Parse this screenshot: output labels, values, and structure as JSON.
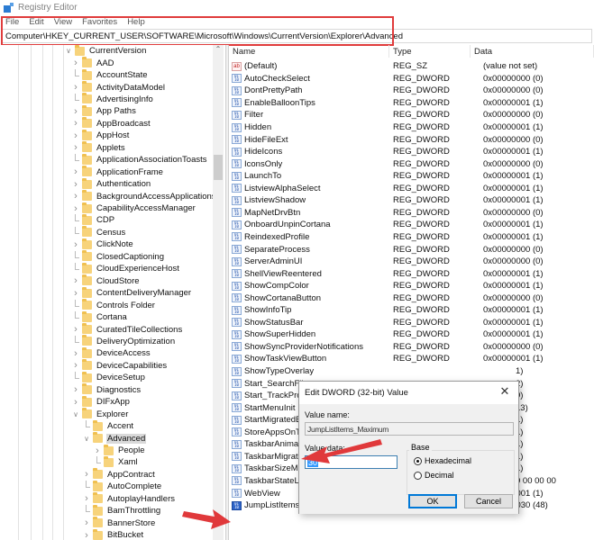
{
  "window": {
    "title": "Registry Editor",
    "app_icon": "registry-editor-icon"
  },
  "menu": [
    "File",
    "Edit",
    "View",
    "Favorites",
    "Help"
  ],
  "address": "Computer\\HKEY_CURRENT_USER\\SOFTWARE\\Microsoft\\Windows\\CurrentVersion\\Explorer\\Advanced",
  "accent": {
    "highlight_box": "#e03c3c",
    "annotation_arrow": "#e0393b",
    "selection": "#d9d9d9"
  },
  "tree": {
    "items": [
      {
        "label": "CurrentVersion",
        "level": 0,
        "expander": "expanded"
      },
      {
        "label": "AAD",
        "level": 1,
        "expander": "collapsed"
      },
      {
        "label": "AccountState",
        "level": 1,
        "expander": "none"
      },
      {
        "label": "ActivityDataModel",
        "level": 1,
        "expander": "collapsed"
      },
      {
        "label": "AdvertisingInfo",
        "level": 1,
        "expander": "none"
      },
      {
        "label": "App Paths",
        "level": 1,
        "expander": "collapsed"
      },
      {
        "label": "AppBroadcast",
        "level": 1,
        "expander": "collapsed"
      },
      {
        "label": "AppHost",
        "level": 1,
        "expander": "collapsed"
      },
      {
        "label": "Applets",
        "level": 1,
        "expander": "collapsed"
      },
      {
        "label": "ApplicationAssociationToasts",
        "level": 1,
        "expander": "none"
      },
      {
        "label": "ApplicationFrame",
        "level": 1,
        "expander": "collapsed"
      },
      {
        "label": "Authentication",
        "level": 1,
        "expander": "collapsed"
      },
      {
        "label": "BackgroundAccessApplications",
        "level": 1,
        "expander": "collapsed"
      },
      {
        "label": "CapabilityAccessManager",
        "level": 1,
        "expander": "collapsed"
      },
      {
        "label": "CDP",
        "level": 1,
        "expander": "none"
      },
      {
        "label": "Census",
        "level": 1,
        "expander": "none"
      },
      {
        "label": "ClickNote",
        "level": 1,
        "expander": "collapsed"
      },
      {
        "label": "ClosedCaptioning",
        "level": 1,
        "expander": "none"
      },
      {
        "label": "CloudExperienceHost",
        "level": 1,
        "expander": "none"
      },
      {
        "label": "CloudStore",
        "level": 1,
        "expander": "collapsed"
      },
      {
        "label": "ContentDeliveryManager",
        "level": 1,
        "expander": "collapsed"
      },
      {
        "label": "Controls Folder",
        "level": 1,
        "expander": "none"
      },
      {
        "label": "Cortana",
        "level": 1,
        "expander": "none"
      },
      {
        "label": "CuratedTileCollections",
        "level": 1,
        "expander": "collapsed"
      },
      {
        "label": "DeliveryOptimization",
        "level": 1,
        "expander": "none"
      },
      {
        "label": "DeviceAccess",
        "level": 1,
        "expander": "collapsed"
      },
      {
        "label": "DeviceCapabilities",
        "level": 1,
        "expander": "collapsed"
      },
      {
        "label": "DeviceSetup",
        "level": 1,
        "expander": "none"
      },
      {
        "label": "Diagnostics",
        "level": 1,
        "expander": "collapsed"
      },
      {
        "label": "DIFxApp",
        "level": 1,
        "expander": "collapsed"
      },
      {
        "label": "Explorer",
        "level": 1,
        "expander": "expanded"
      },
      {
        "label": "Accent",
        "level": 2,
        "expander": "none"
      },
      {
        "label": "Advanced",
        "level": 2,
        "expander": "expanded",
        "selected": true
      },
      {
        "label": "People",
        "level": 3,
        "expander": "collapsed"
      },
      {
        "label": "Xaml",
        "level": 3,
        "expander": "none"
      },
      {
        "label": "AppContract",
        "level": 2,
        "expander": "collapsed"
      },
      {
        "label": "AutoComplete",
        "level": 2,
        "expander": "none"
      },
      {
        "label": "AutoplayHandlers",
        "level": 2,
        "expander": "collapsed"
      },
      {
        "label": "BamThrottling",
        "level": 2,
        "expander": "none"
      },
      {
        "label": "BannerStore",
        "level": 2,
        "expander": "collapsed"
      },
      {
        "label": "BitBucket",
        "level": 2,
        "expander": "collapsed"
      }
    ]
  },
  "list": {
    "columns": {
      "name": "Name",
      "type": "Type",
      "data": "Data"
    },
    "rows": [
      {
        "name": "(Default)",
        "type": "REG_SZ",
        "data": "(value not set)",
        "icon": "string-value-icon"
      },
      {
        "name": "AutoCheckSelect",
        "type": "REG_DWORD",
        "data": "0x00000000 (0)",
        "icon": "dword-value-icon"
      },
      {
        "name": "DontPrettyPath",
        "type": "REG_DWORD",
        "data": "0x00000000 (0)",
        "icon": "dword-value-icon"
      },
      {
        "name": "EnableBalloonTips",
        "type": "REG_DWORD",
        "data": "0x00000001 (1)",
        "icon": "dword-value-icon"
      },
      {
        "name": "Filter",
        "type": "REG_DWORD",
        "data": "0x00000000 (0)",
        "icon": "dword-value-icon"
      },
      {
        "name": "Hidden",
        "type": "REG_DWORD",
        "data": "0x00000001 (1)",
        "icon": "dword-value-icon"
      },
      {
        "name": "HideFileExt",
        "type": "REG_DWORD",
        "data": "0x00000000 (0)",
        "icon": "dword-value-icon"
      },
      {
        "name": "HideIcons",
        "type": "REG_DWORD",
        "data": "0x00000001 (1)",
        "icon": "dword-value-icon"
      },
      {
        "name": "IconsOnly",
        "type": "REG_DWORD",
        "data": "0x00000000 (0)",
        "icon": "dword-value-icon"
      },
      {
        "name": "LaunchTo",
        "type": "REG_DWORD",
        "data": "0x00000001 (1)",
        "icon": "dword-value-icon"
      },
      {
        "name": "ListviewAlphaSelect",
        "type": "REG_DWORD",
        "data": "0x00000001 (1)",
        "icon": "dword-value-icon"
      },
      {
        "name": "ListviewShadow",
        "type": "REG_DWORD",
        "data": "0x00000001 (1)",
        "icon": "dword-value-icon"
      },
      {
        "name": "MapNetDrvBtn",
        "type": "REG_DWORD",
        "data": "0x00000000 (0)",
        "icon": "dword-value-icon"
      },
      {
        "name": "OnboardUnpinCortana",
        "type": "REG_DWORD",
        "data": "0x00000001 (1)",
        "icon": "dword-value-icon"
      },
      {
        "name": "ReindexedProfile",
        "type": "REG_DWORD",
        "data": "0x00000001 (1)",
        "icon": "dword-value-icon"
      },
      {
        "name": "SeparateProcess",
        "type": "REG_DWORD",
        "data": "0x00000000 (0)",
        "icon": "dword-value-icon"
      },
      {
        "name": "ServerAdminUI",
        "type": "REG_DWORD",
        "data": "0x00000000 (0)",
        "icon": "dword-value-icon"
      },
      {
        "name": "ShellViewReentered",
        "type": "REG_DWORD",
        "data": "0x00000001 (1)",
        "icon": "dword-value-icon"
      },
      {
        "name": "ShowCompColor",
        "type": "REG_DWORD",
        "data": "0x00000001 (1)",
        "icon": "dword-value-icon"
      },
      {
        "name": "ShowCortanaButton",
        "type": "REG_DWORD",
        "data": "0x00000000 (0)",
        "icon": "dword-value-icon"
      },
      {
        "name": "ShowInfoTip",
        "type": "REG_DWORD",
        "data": "0x00000001 (1)",
        "icon": "dword-value-icon"
      },
      {
        "name": "ShowStatusBar",
        "type": "REG_DWORD",
        "data": "0x00000001 (1)",
        "icon": "dword-value-icon"
      },
      {
        "name": "ShowSuperHidden",
        "type": "REG_DWORD",
        "data": "0x00000001 (1)",
        "icon": "dword-value-icon"
      },
      {
        "name": "ShowSyncProviderNotifications",
        "type": "REG_DWORD",
        "data": "0x00000000 (0)",
        "icon": "dword-value-icon"
      },
      {
        "name": "ShowTaskViewButton",
        "type": "REG_DWORD",
        "data": "0x00000001 (1)",
        "icon": "dword-value-icon"
      },
      {
        "name": "ShowTypeOverlay",
        "type": "",
        "data": "1)",
        "icon": "dword-value-icon"
      },
      {
        "name": "Start_SearchFiles",
        "type": "",
        "data": "2)",
        "icon": "dword-value-icon"
      },
      {
        "name": "Start_TrackProgs",
        "type": "",
        "data": "0)",
        "icon": "dword-value-icon"
      },
      {
        "name": "StartMenuInit",
        "type": "",
        "data": "13)",
        "icon": "dword-value-icon"
      },
      {
        "name": "StartMigratedBrowserPin",
        "type": "",
        "data": "1)",
        "icon": "dword-value-icon"
      },
      {
        "name": "StoreAppsOnTaskbar",
        "type": "",
        "data": "1)",
        "icon": "dword-value-icon"
      },
      {
        "name": "TaskbarAnimations",
        "type": "",
        "data": "1)",
        "icon": "dword-value-icon"
      },
      {
        "name": "TaskbarMigratedBrowserPin",
        "type": "",
        "data": "1)",
        "icon": "dword-value-icon"
      },
      {
        "name": "TaskbarSizeMove",
        "type": "",
        "data": "1)",
        "icon": "dword-value-icon"
      },
      {
        "name": "TaskbarStateLastRun",
        "type": "",
        "data": "0 00 00 00",
        "icon": "binary-value-icon"
      },
      {
        "name": "WebView",
        "type": "REG_DWORD",
        "data": "0x00000001 (1)",
        "icon": "dword-value-icon"
      },
      {
        "name": "JumpListItems_Maximum",
        "type": "REG_DWORD",
        "data": "0x00000030 (48)",
        "icon": "dword-value-icon",
        "selected": true
      }
    ]
  },
  "dialog": {
    "title": "Edit DWORD (32-bit) Value",
    "close_glyph": "✕",
    "value_name_label": "Value name:",
    "value_name": "JumpListItems_Maximum",
    "value_data_label": "Value data:",
    "value_data": "30",
    "base_label": "Base",
    "base_options": [
      {
        "label": "Hexadecimal",
        "checked": true
      },
      {
        "label": "Decimal",
        "checked": false
      }
    ],
    "ok_label": "OK",
    "cancel_label": "Cancel"
  }
}
